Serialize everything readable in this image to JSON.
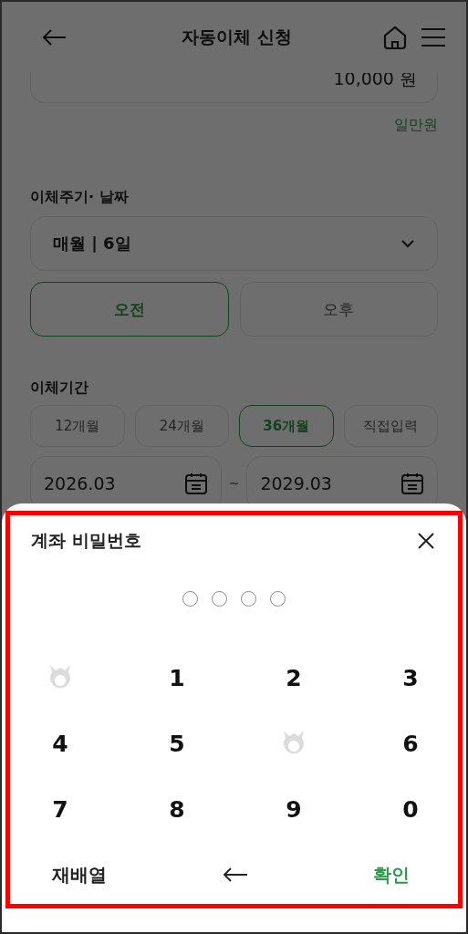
{
  "header": {
    "title": "자동이체 신청"
  },
  "amount": {
    "value": "10,000 원",
    "in_words": "일만원"
  },
  "cycle": {
    "label": "이체주기· 날짜",
    "value": "매월 | 6일",
    "time_options": [
      {
        "label": "오전",
        "selected": true
      },
      {
        "label": "오후",
        "selected": false
      }
    ]
  },
  "period": {
    "label": "이체기간",
    "options": [
      {
        "label": "12개월",
        "selected": false
      },
      {
        "label": "24개월",
        "selected": false
      },
      {
        "label": "36개월",
        "selected": true
      },
      {
        "label": "직접입력",
        "selected": false
      }
    ],
    "start": "2026.03",
    "separator": "~",
    "end": "2029.03"
  },
  "pin_sheet": {
    "title": "계좌 비밀번호",
    "pin_dots": [
      {
        "filled": false
      },
      {
        "filled": false
      },
      {
        "filled": false
      },
      {
        "filled": false
      }
    ],
    "keys": [
      {
        "kind": "blank"
      },
      {
        "kind": "digit",
        "label": "1"
      },
      {
        "kind": "digit",
        "label": "2"
      },
      {
        "kind": "digit",
        "label": "3"
      },
      {
        "kind": "digit",
        "label": "4"
      },
      {
        "kind": "digit",
        "label": "5"
      },
      {
        "kind": "blank"
      },
      {
        "kind": "digit",
        "label": "6"
      },
      {
        "kind": "digit",
        "label": "7"
      },
      {
        "kind": "digit",
        "label": "8"
      },
      {
        "kind": "digit",
        "label": "9"
      },
      {
        "kind": "digit",
        "label": "0"
      }
    ],
    "shuffle": "재배열",
    "confirm": "확인"
  }
}
